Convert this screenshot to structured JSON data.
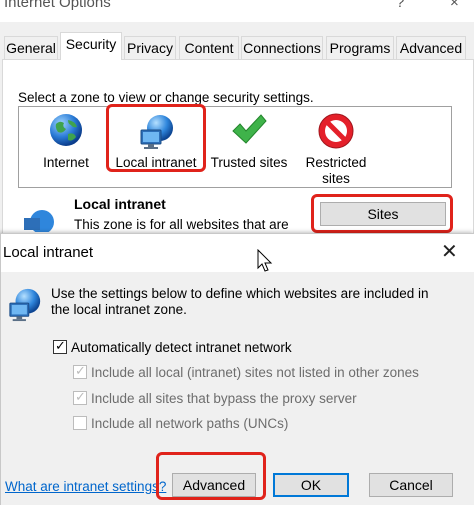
{
  "internet_options": {
    "title": "Internet Options",
    "help_glyph": "?",
    "close_glyph": "×",
    "tabs": [
      {
        "label": "General",
        "active": false
      },
      {
        "label": "Security",
        "active": true
      },
      {
        "label": "Privacy",
        "active": false
      },
      {
        "label": "Content",
        "active": false
      },
      {
        "label": "Connections",
        "active": false
      },
      {
        "label": "Programs",
        "active": false
      },
      {
        "label": "Advanced",
        "active": false
      }
    ],
    "zone_prompt": "Select a zone to view or change security settings.",
    "zones": [
      {
        "label": "Internet",
        "icon": "globe-icon"
      },
      {
        "label": "Local intranet",
        "icon": "intranet-icon",
        "selected": true
      },
      {
        "label": "Trusted sites",
        "icon": "checkmark-icon"
      },
      {
        "label": "Restricted sites",
        "line1": "Restricted",
        "line2": "sites",
        "icon": "no-entry-icon"
      }
    ],
    "zone_heading": "Local intranet",
    "zone_description": "This zone is for all websites that are",
    "sites_button": "Sites"
  },
  "local_intranet_dialog": {
    "title": "Local intranet",
    "close_glyph": "✕",
    "intro": "Use the settings below to define which websites are included in the local intranet zone.",
    "options": [
      {
        "label": "Automatically detect intranet network",
        "checked": true,
        "enabled": true
      },
      {
        "label": "Include all local (intranet) sites not listed in other zones",
        "checked": true,
        "enabled": false
      },
      {
        "label": "Include all sites that bypass the proxy server",
        "checked": true,
        "enabled": false
      },
      {
        "label": "Include all network paths (UNCs)",
        "checked": false,
        "enabled": false
      }
    ],
    "link": "What are intranet settings?",
    "buttons": {
      "advanced": "Advanced",
      "ok": "OK",
      "cancel": "Cancel"
    }
  },
  "colors": {
    "highlight": "#e0231b",
    "link": "#0066cc",
    "default_button_border": "#0078d7"
  }
}
